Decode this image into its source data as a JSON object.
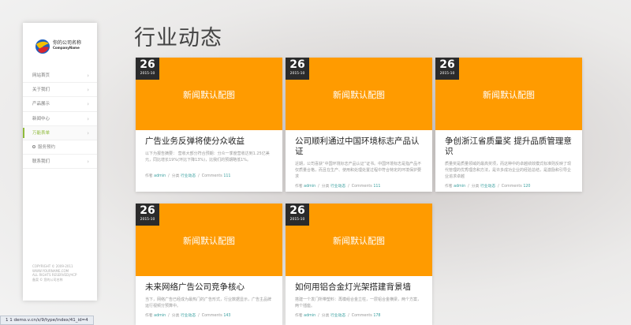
{
  "brand": {
    "name": "你的公司名称",
    "name_en": "CompanyName",
    "colors": {
      "accent": "#ff9b00",
      "nav_active": "#8fba3a",
      "date_bg": "#2b2b2b",
      "link": "#3aa0a0"
    }
  },
  "nav": {
    "items": [
      {
        "label": "网站首页",
        "chevron": "›",
        "active": false
      },
      {
        "label": "关于我们",
        "chevron": "›",
        "active": false
      },
      {
        "label": "产品展示",
        "chevron": "›",
        "active": false
      },
      {
        "label": "新闻中心",
        "chevron": "›",
        "active": false
      },
      {
        "label": "万能表单",
        "chevron": "›",
        "active": true
      },
      {
        "label": "服务预约",
        "chevron": "",
        "active": false,
        "sub": true
      },
      {
        "label": "联系我们",
        "chevron": "›",
        "active": false
      }
    ]
  },
  "copyright": {
    "line1": "COPYRIGHT © 2009-2011",
    "line2": "WWW.YOURNAME.COM",
    "line3": "ALL RIGHTS RESERVED沪ICP",
    "line4": "备案 © 您的公司名称"
  },
  "page": {
    "title": "行业动态"
  },
  "meta_labels": {
    "author": "作者",
    "category": "分类",
    "comments": "Comments"
  },
  "cards": [
    {
      "day": "26",
      "ym": "2015-10",
      "image_label": "新闻默认配图",
      "title": "广告业务反弹将使分众收益",
      "excerpt": "以下为报告摘要：   营收大部分符合预期：分众一季度营收达到1.25亿美元，同比增长19%(环比下降13%)，比我们的预期略低1%。",
      "author": "admin",
      "category": "行业动态",
      "comments": "111"
    },
    {
      "day": "26",
      "ym": "2015-10",
      "image_label": "新闻默认配图",
      "title": "公司顺利通过中国环境标志产品认证",
      "excerpt": "近期，公司喜获“中国环境标志产品认证”证书。中国环境标志是指产品不仅质量合格，而且在生产、使用和处理处置过程中符合特定的环境保护要求",
      "author": "admin",
      "category": "行业动态",
      "comments": "111"
    },
    {
      "day": "26",
      "ym": "2015-10",
      "image_label": "新闻默认配图",
      "title": "争创浙江省质量奖 提升品质管理意识",
      "excerpt": "质量奖是质量领域的最高奖项，而这种中的卓越绩效模式标准则反映了现代管理的优秀理念和方法，是许多成功企业的经验总结，是激励和引导企业追求卓越",
      "author": "admin",
      "category": "行业动态",
      "comments": "120"
    },
    {
      "day": "26",
      "ym": "2015-10",
      "image_label": "新闻默认配图",
      "title": "未来网络广告公司竞争核心",
      "excerpt": "当下，网络广告已经成为最热门的广告形式，行业数据显示，广告主品牌运行视频分预算中。",
      "author": "admin",
      "category": "行业动态",
      "comments": "143"
    },
    {
      "day": "26",
      "ym": "2015-10",
      "image_label": "新闻默认配图",
      "title": "如何用铝合金灯光架搭建背景墙",
      "excerpt": "搭建一个发门所带塑料：再模组合金立柱，一层铝合金横梁，两个方案，两个插座。",
      "author": "admin",
      "category": "行业动态",
      "comments": "178"
    }
  ],
  "status": {
    "url": "1 1 demo.v.cn/s/9/type/index/41_id=4"
  }
}
